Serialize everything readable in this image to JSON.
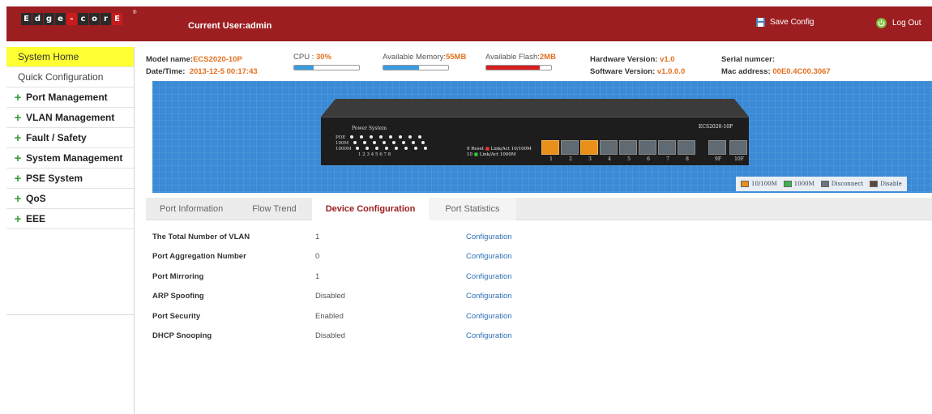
{
  "header": {
    "logo_chars": [
      "E",
      "d",
      "g",
      "e",
      "-",
      "c",
      "o",
      "r",
      "E"
    ],
    "logo_registered": "®",
    "current_user": "Current User:admin",
    "save_config": "Save Config",
    "logout": "Log Out"
  },
  "colors": {
    "header_bg": "#9d1e21",
    "active_nav": "#ffff33",
    "panel_bg": "#3a8ad6",
    "value_orange": "#e4701e",
    "link_blue": "#2d6fb5"
  },
  "sidebar": {
    "items": [
      {
        "label": "System Home",
        "type": "active"
      },
      {
        "label": "Quick Configuration",
        "type": "plain"
      },
      {
        "label": "Port Management",
        "type": "group"
      },
      {
        "label": "VLAN Management",
        "type": "group"
      },
      {
        "label": "Fault / Safety",
        "type": "group"
      },
      {
        "label": "System Management",
        "type": "group"
      },
      {
        "label": "PSE System",
        "type": "group"
      },
      {
        "label": "QoS",
        "type": "group"
      },
      {
        "label": "EEE",
        "type": "group"
      }
    ]
  },
  "info": {
    "model_label": "Model name:",
    "model_value": "ECS2020-10P",
    "datetime_label": "Date/Time:",
    "datetime_value": "2013-12-5 00:17:43",
    "cpu_label": "CPU :",
    "cpu_value": "30%",
    "cpu_usage": 0.3,
    "memory_label": "Available Memory:",
    "memory_value": "55MB",
    "memory_usage": 0.55,
    "flash_label": "Available Flash:",
    "flash_value": "2MB",
    "flash_usage": 0.82,
    "hw_label": "Hardware Version:",
    "hw_value": "v1.0",
    "sw_label": "Software Version:",
    "sw_value": "v1.0.0.0",
    "serial_label": "Serial numcer:",
    "serial_value": "",
    "mac_label": "Mac address:",
    "mac_value": "00E0.4C00.3067"
  },
  "device": {
    "power_system": "Power System",
    "led_rows": [
      "POE",
      "100M",
      "1000M"
    ],
    "led_numbers": "1  2  3  4  5  6  7  8",
    "reset_9": "9 Reset",
    "reset_10": "10",
    "link_act_1": "Link/Act 10/100M",
    "link_act_2": "Link/Act 1000M",
    "model": "ECS2020-10P",
    "ports": [
      {
        "num": "1",
        "on": true
      },
      {
        "num": "2",
        "on": false
      },
      {
        "num": "3",
        "on": true
      },
      {
        "num": "4",
        "on": false
      },
      {
        "num": "5",
        "on": false
      },
      {
        "num": "6",
        "on": false
      },
      {
        "num": "7",
        "on": false
      },
      {
        "num": "8",
        "on": false
      }
    ],
    "sfp_ports": [
      "9F",
      "10F"
    ],
    "legend": [
      "10/100M",
      "1000M",
      "Disconnect",
      "Disable"
    ]
  },
  "tabs": [
    {
      "label": "Port Information",
      "active": false
    },
    {
      "label": "Flow Trend",
      "active": false
    },
    {
      "label": "Device Configuration",
      "active": true
    },
    {
      "label": "Port Statistics",
      "active": false
    }
  ],
  "config": {
    "link_text": "Configuration",
    "rows": [
      {
        "label": "The Total Number of VLAN",
        "value": "1"
      },
      {
        "label": "Port Aggregation Number",
        "value": "0"
      },
      {
        "label": "Port Mirroring",
        "value": "1"
      },
      {
        "label": "ARP Spoofing",
        "value": "Disabled"
      },
      {
        "label": "Port Security",
        "value": "Enabled"
      },
      {
        "label": "DHCP Snooping",
        "value": "Disabled"
      }
    ]
  }
}
